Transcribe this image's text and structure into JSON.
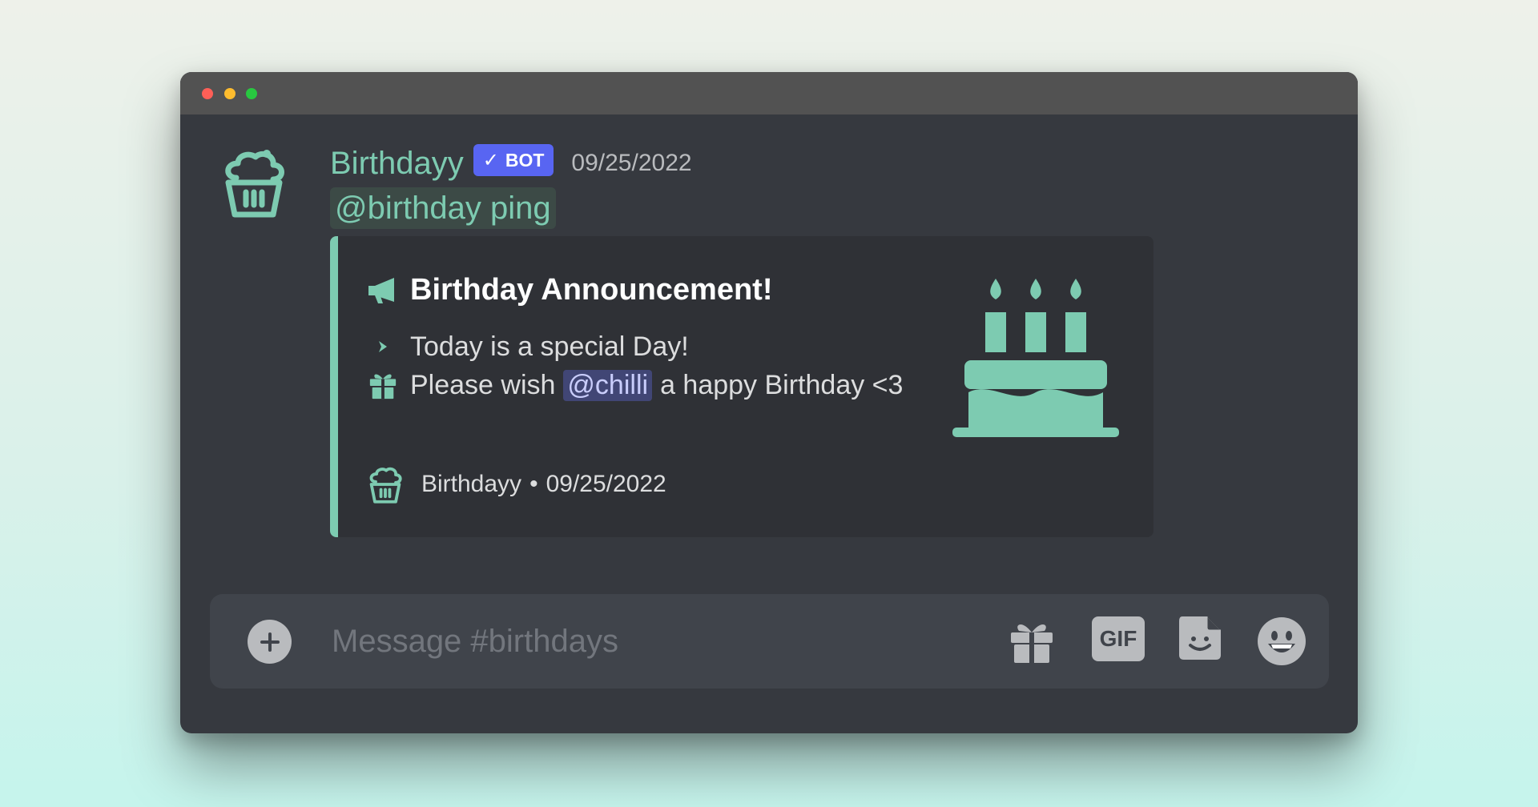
{
  "window": {
    "controls": [
      "close",
      "minimize",
      "maximize"
    ]
  },
  "message": {
    "avatar_icon": "cupcake-icon",
    "username": "Birthdayy",
    "bot_badge": {
      "check_icon": "checkmark-icon",
      "label": "BOT",
      "color": "#5865f2"
    },
    "timestamp": "09/25/2022",
    "role_mention": "@birthday ping"
  },
  "embed": {
    "accent_color": "#7dcbb1",
    "title_icon": "megaphone-icon",
    "title": "Birthday Announcement!",
    "line1": {
      "icon": "chevron-right-icon",
      "text": "Today is a special Day!"
    },
    "line2": {
      "icon": "gift-icon",
      "prefix": "Please wish",
      "mention": "@chilli",
      "suffix": "a happy Birthday <3"
    },
    "thumbnail_icon": "birthday-cake-icon",
    "footer": {
      "icon": "cupcake-icon",
      "name": "Birthdayy",
      "separator": "•",
      "date": "09/25/2022"
    }
  },
  "composer": {
    "add_icon": "plus-circle-icon",
    "placeholder": "Message #birthdays",
    "gift_icon": "gift-icon",
    "gif_label": "GIF",
    "sticker_icon": "sticker-icon",
    "emoji_icon": "smiley-icon"
  }
}
